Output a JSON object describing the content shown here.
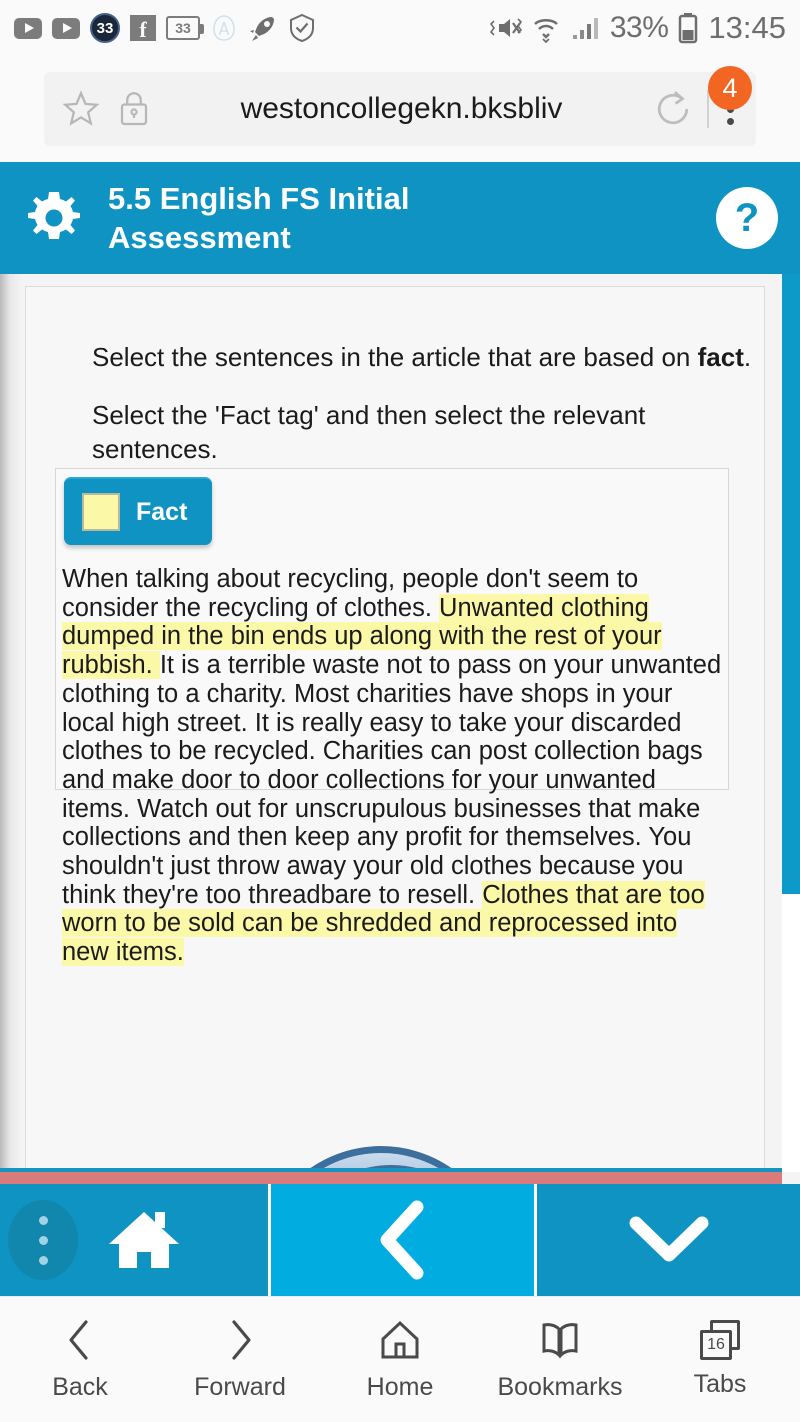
{
  "status_bar": {
    "left_icons": [
      "youtube-play-icon",
      "youtube-play-icon",
      "badge-33-icon",
      "facebook-icon",
      "battery-33-icon",
      "assistant-a-icon",
      "rocket-icon",
      "shield-check-icon"
    ],
    "badge_value": "33",
    "battery_icon_value": "33",
    "facebook_letter": "f",
    "assistant_letter": "A",
    "right_icons": [
      "mute-vibrate-icon",
      "wifi-icon",
      "signal-icon",
      "battery-icon"
    ],
    "battery_percent": "33%",
    "clock": "13:45"
  },
  "browser": {
    "url": "westoncollegekn.bksbliv",
    "star_icon": "bookmark-star-icon",
    "lock_icon": "padlock-icon",
    "reload_icon": "reload-icon",
    "menu_icon": "kebab-menu-icon",
    "tab_badge": "4",
    "tab_badge_color": "#f26522"
  },
  "app_header": {
    "gear_icon": "gear-icon",
    "title": "5.5 English FS Initial Assessment",
    "help_label": "?",
    "accent_color": "#0e93c2"
  },
  "question": {
    "instruction_1_prefix": "Select the sentences in the article that are based on ",
    "instruction_1_bold": "fact",
    "instruction_1_suffix": ".",
    "instruction_2": "Select the 'Fact tag' and then select the relevant sentences."
  },
  "fact_tag": {
    "label": "Fact",
    "swatch_color": "#fbf8a8",
    "button_color": "#0e93c2"
  },
  "article": {
    "highlight_color": "#fbf8a8",
    "segments": [
      {
        "text": " When talking about recycling, people don't seem to consider the recycling of clothes. ",
        "highlighted": false
      },
      {
        "text": " Unwanted clothing dumped in the bin ends up along with the rest of your rubbish. ",
        "highlighted": true
      },
      {
        "text": " It is a terrible waste not to pass on your unwanted clothing to a charity.  Most charities have shops in your local high street.  It is really easy to take your discarded clothes to be recycled.  Charities can post collection bags and make door to door collections for your unwanted items.  Watch out for unscrupulous businesses that make collections and then keep any profit for themselves.  You shouldn't just throw away your old clothes because you think they're too threadbare to resell. ",
        "highlighted": false
      },
      {
        "text": " Clothes that are too worn to be sold can be shredded and reprocessed into new items. ",
        "highlighted": true
      }
    ]
  },
  "graphic": {
    "name": "recycling-arrow-graphic",
    "color": "#5b8fc0"
  },
  "scrollbar": {
    "color": "#0e9ac9"
  },
  "app_toolbar": {
    "menu_icon": "kebab-menu-icon",
    "home_icon": "home-icon",
    "back_icon": "chevron-left-icon",
    "down_icon": "chevron-down-icon",
    "segment_color": "#0e93c2",
    "active_segment_color": "#00ace0"
  },
  "browser_nav": {
    "items": [
      {
        "label": "Back",
        "icon": "chevron-left-icon"
      },
      {
        "label": "Forward",
        "icon": "chevron-right-icon"
      },
      {
        "label": "Home",
        "icon": "home-outline-icon"
      },
      {
        "label": "Bookmarks",
        "icon": "book-open-icon"
      },
      {
        "label": "Tabs",
        "icon": "tabs-icon",
        "count": "16"
      }
    ]
  }
}
